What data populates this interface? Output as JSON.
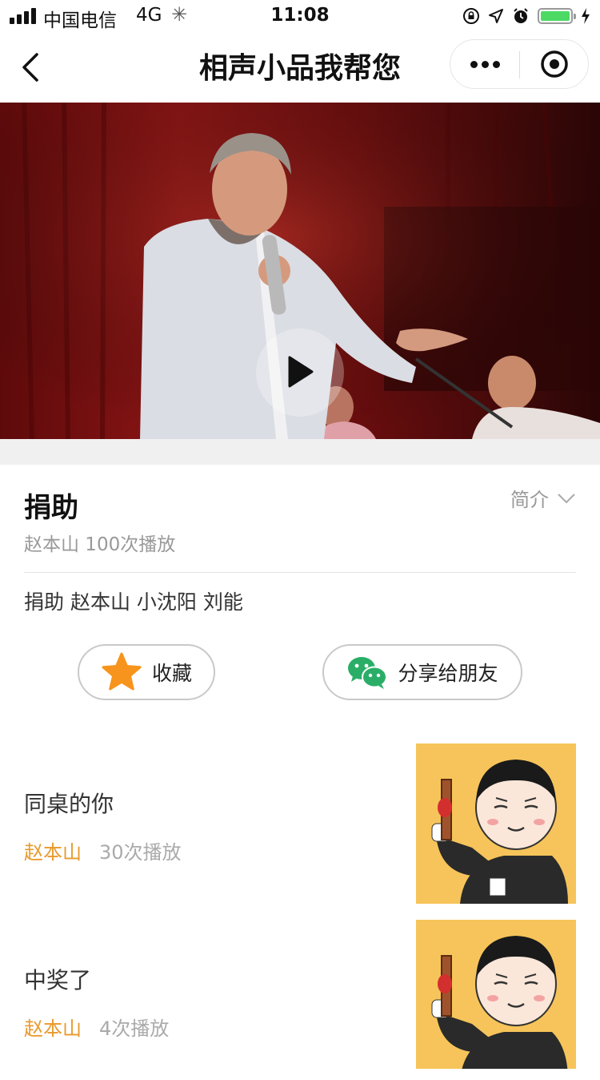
{
  "status_bar": {
    "carrier": "中国电信",
    "network": "4G",
    "time": "11:08",
    "battery_color": "#4cd964",
    "battery_level": 1.0
  },
  "nav": {
    "title": "相声小品我帮您"
  },
  "video": {
    "play_icon": "play-icon"
  },
  "detail": {
    "title": "捐助",
    "intro_label": "简介",
    "meta": "赵本山 100次播放",
    "tags": "捐助 赵本山 小沈阳 刘能",
    "favorite_label": "收藏",
    "share_label": "分享给朋友"
  },
  "list": [
    {
      "title": "同桌的你",
      "author": "赵本山",
      "plays": "30次播放"
    },
    {
      "title": "中奖了",
      "author": "赵本山",
      "plays": "4次播放"
    }
  ],
  "colors": {
    "accent_orange": "#e89a2d",
    "star": "#f7941d",
    "wechat_green": "#2aae67",
    "thumb_bg": "#f6c45a"
  }
}
